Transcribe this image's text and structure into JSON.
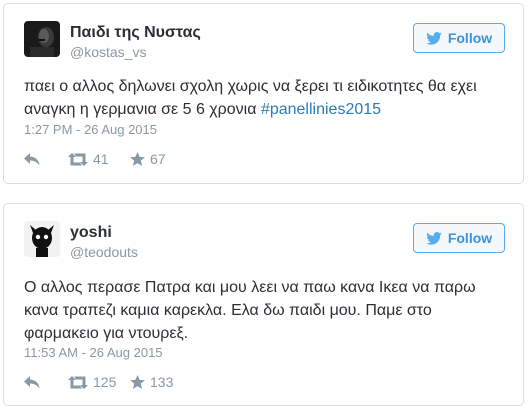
{
  "tweets": [
    {
      "name": "Παιδι της Νυστας",
      "handle": "@kostas_vs",
      "follow_label": "Follow",
      "text_plain": "παει ο αλλος δηλωνει σχολη χωρις να ξερει τι ειδικοτητες θα εχει αναγκη η γερμανια σε 5 6 χρονια ",
      "hashtag": "#panellinies2015",
      "timestamp": "1:27 PM - 26 Aug 2015",
      "retweets": "41",
      "favorites": "67",
      "icons": {
        "reply": "reply-icon",
        "retweet": "retweet-icon",
        "favorite": "star-icon"
      }
    },
    {
      "name": "yoshi",
      "handle": "@teodouts",
      "follow_label": "Follow",
      "text_plain": "Ο αλλος περασε Πατρα και μου λεει να παω κανα Ικεα να παρω κανα τραπεζι καμια καρεκλα. Ελα δω παιδι μου. Παμε στο φαρμακειο για ντουρεξ.",
      "timestamp": "11:53 AM - 26 Aug 2015",
      "retweets": "125",
      "favorites": "133",
      "icons": {
        "reply": "reply-icon",
        "retweet": "retweet-icon",
        "favorite": "star-icon"
      }
    }
  ],
  "colors": {
    "accent": "#55acee",
    "follow_text": "#3b94d9",
    "hashtag": "#2b7bb9",
    "meta": "#8899a6",
    "text": "#292f33",
    "border": "#d8dee2"
  }
}
